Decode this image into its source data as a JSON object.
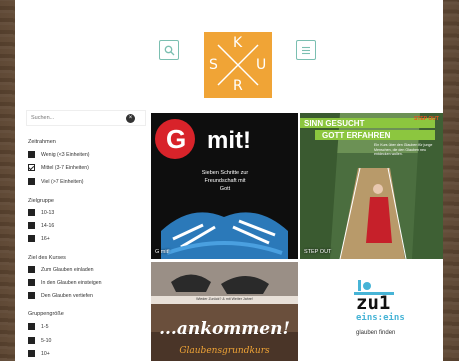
{
  "logo": {
    "letters": [
      "S",
      "K",
      "U",
      "R"
    ]
  },
  "header": {
    "search_icon": "search-icon",
    "menu_icon": "menu-icon"
  },
  "search": {
    "placeholder": "Suchen..."
  },
  "filters": [
    {
      "title": "Zeitrahmen",
      "options": [
        {
          "label": "Wenig (<3 Einheiten)",
          "checked": false
        },
        {
          "label": "Mittel (3-7 Einheiten)",
          "checked": true
        },
        {
          "label": "Viel (>7 Einheiten)",
          "checked": false
        }
      ]
    },
    {
      "title": "Zielgruppe",
      "options": [
        {
          "label": "10-13",
          "checked": false
        },
        {
          "label": "14-16",
          "checked": false
        },
        {
          "label": "16+",
          "checked": false
        }
      ]
    },
    {
      "title": "Ziel des Kurses",
      "options": [
        {
          "label": "Zum Glauben einladen",
          "checked": false
        },
        {
          "label": "In den Glauben einsteigen",
          "checked": false
        },
        {
          "label": "Den Glauben vertiefen",
          "checked": false
        }
      ]
    },
    {
      "title": "Gruppengröße",
      "options": [
        {
          "label": "1-5",
          "checked": false
        },
        {
          "label": "5-10",
          "checked": false
        },
        {
          "label": "10+",
          "checked": false
        }
      ]
    }
  ],
  "tiles": [
    {
      "label": "G mit!",
      "art_title": "mit!",
      "art_letter": "G",
      "art_subtitle": "Sieben Schritte zur Freundschaft mit Gott",
      "bg": "#111111",
      "accent": "#d8232a"
    },
    {
      "label": "STEP OUT",
      "art_title_top": "SINN GESUCHT",
      "art_title_bottom": "GOTT ERFAHREN",
      "art_badge": "STEP OUT",
      "art_text": "Ein Kurs über den Glauben für junge Menschen, die den Glauben neu entdecken wollen.",
      "accent": "#e8521f",
      "green": "#8cc63f"
    },
    {
      "banner": "Wieder Zurück? & mit Weiter Jahre!",
      "art_title": "...ankommen!",
      "art_subtitle": "Glaubensgrundkurs"
    },
    {
      "art_line1": "zu1",
      "art_line2": "eins:eins",
      "art_caption": "glauben finden",
      "accent": "#47b4d6"
    }
  ]
}
